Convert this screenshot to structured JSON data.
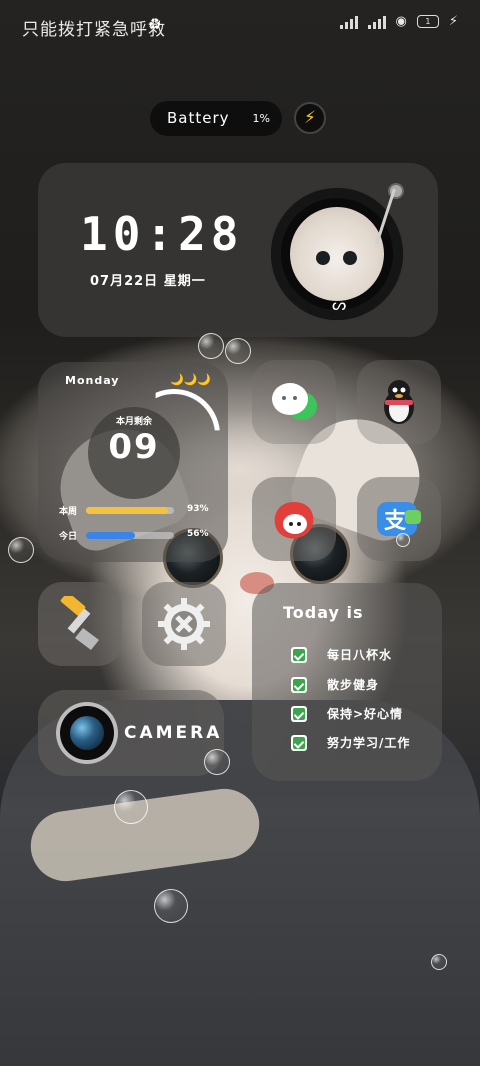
{
  "status_bar": {
    "carrier_text": "只能拨打紧急呼救",
    "right_icons": [
      "signal-x-icon",
      "signal-x-icon",
      "hotspot-icon",
      "battery-icon",
      "charging-icon"
    ]
  },
  "battery_widget": {
    "label": "Battery",
    "percent": "1%"
  },
  "clock_widget": {
    "time": "10:28",
    "date": "07月22日 星期一"
  },
  "calendar_widget": {
    "weekday": "Monday",
    "moons": "🌙🌙🌙",
    "ring_label": "本月剩余",
    "ring_value": "09",
    "bars": [
      {
        "label": "本周",
        "value": "93%",
        "fraction": 0.93,
        "color": "#f5c141"
      },
      {
        "label": "今日",
        "value": "56%",
        "fraction": 0.56,
        "color": "#3b83e6"
      }
    ]
  },
  "todo_widget": {
    "title": "Today is",
    "items": [
      "每日八杯水",
      "散步健身",
      "保持>好心情",
      "努力学习/工作"
    ]
  },
  "camera_widget": {
    "label": "CAMERA"
  },
  "apps": [
    {
      "name": "wechat",
      "icon": "wechat-icon"
    },
    {
      "name": "qq",
      "icon": "qq-penguin-icon"
    },
    {
      "name": "weibo",
      "icon": "weibo-icon"
    },
    {
      "name": "alipay",
      "icon": "alipay-icon"
    },
    {
      "name": "cleaner",
      "icon": "broom-icon"
    },
    {
      "name": "settings",
      "icon": "gear-icon"
    }
  ],
  "colors": {
    "accent_yellow": "#f5c141",
    "accent_blue": "#3b83e6",
    "check_green": "#3aa54b",
    "netease_red": "#e53b2c"
  }
}
